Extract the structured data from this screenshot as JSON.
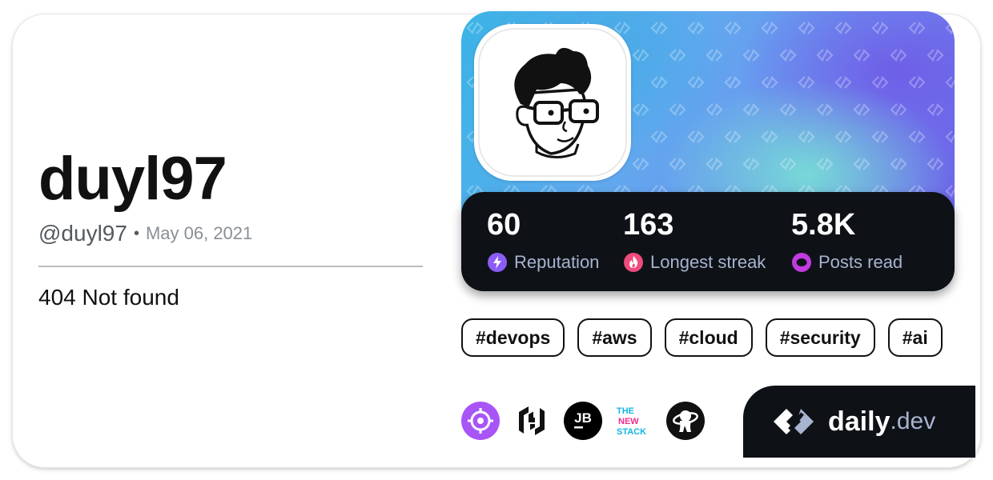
{
  "profile": {
    "name": "duyl97",
    "handle": "@duyl97",
    "separator": "•",
    "joined": "May 06, 2021",
    "bio": "404 Not found"
  },
  "stats": [
    {
      "value": "60",
      "label": "Reputation",
      "icon": "lightning-icon",
      "color": "#8b5cf6"
    },
    {
      "value": "163",
      "label": "Longest streak",
      "icon": "flame-icon",
      "color": "#ef4b7d"
    },
    {
      "value": "5.8K",
      "label": "Posts read",
      "icon": "ring-icon",
      "color": "#c13bdf"
    }
  ],
  "tags": [
    "#devops",
    "#aws",
    "#cloud",
    "#security",
    "#ai"
  ],
  "sources": [
    {
      "icon": "crosshair-source-icon",
      "color": "#a855f7"
    },
    {
      "icon": "hashicorp-source-icon",
      "color": "#111111"
    },
    {
      "icon": "jetbrains-source-icon",
      "color": "#000000",
      "text": "JB"
    },
    {
      "icon": "the-new-stack-source-icon",
      "lines": [
        "THE",
        "NEW",
        "STACK"
      ]
    },
    {
      "icon": "astronaut-source-icon",
      "color": "#111111"
    }
  ],
  "brand": {
    "icon": "daily-dev-logo-icon",
    "name": "daily",
    "suffix": ".dev"
  }
}
